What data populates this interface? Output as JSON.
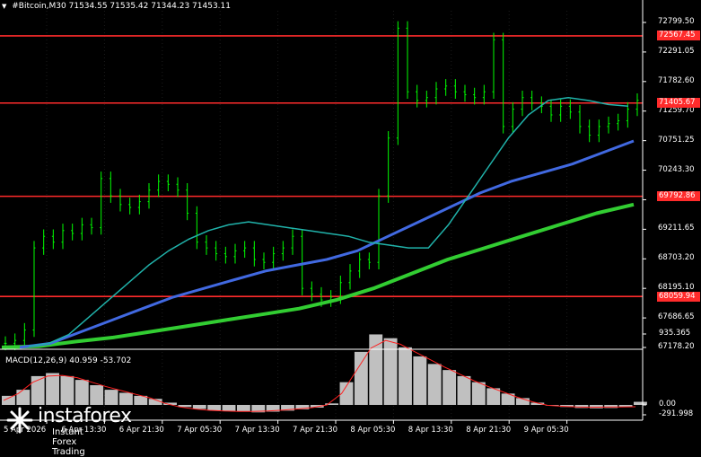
{
  "header": {
    "symbol": "#Bitcoin,M30",
    "ohlc": "71534.55 71535.42 71344.23 71453.11"
  },
  "indicator_label": "MACD(12,26,9) 40.959 -53.702",
  "watermark": {
    "name": "instaforex",
    "tagline": "Instant Forex Trading"
  },
  "price_axis": {
    "ticks": [
      "72799.50",
      "72291.05",
      "71782.60",
      "71259.70",
      "70751.25",
      "70243.30",
      "69735.35",
      "69211.65",
      "68703.20",
      "68195.10",
      "67686.65",
      "67178.20"
    ]
  },
  "horizontal_levels": [
    {
      "label": "72567.45",
      "color": "#ff2b2b"
    },
    {
      "label": "71405.67",
      "color": "#ff2b2b"
    },
    {
      "label": "69792.86",
      "color": "#ff2b2b"
    },
    {
      "label": "68059.94",
      "color": "#ff2b2b"
    }
  ],
  "macd_axis": {
    "ticks": [
      "935.365",
      "0.00",
      "-291.998"
    ]
  },
  "time_axis": {
    "labels": [
      "5 Apr 2026",
      "6 Apr 13:30",
      "6 Apr 21:30",
      "7 Apr 05:30",
      "7 Apr 13:30",
      "7 Apr 21:30",
      "8 Apr 05:30",
      "8 Apr 13:30",
      "8 Apr 21:30",
      "9 Apr 05:30"
    ]
  },
  "colors": {
    "background": "#000000",
    "candles": "#00ff00",
    "ma_fast": "#20b2aa",
    "ma_mid": "#4169e1",
    "ma_slow": "#32cd32",
    "macd_hist": "#c0c0c0",
    "macd_signal": "#ff2020",
    "level": "#ff2b2b"
  },
  "chart_data": {
    "type": "line",
    "title": "#Bitcoin,M30",
    "close_series": [
      67250,
      67300,
      67480,
      68900,
      69100,
      69000,
      69200,
      69150,
      69300,
      69250,
      70100,
      69800,
      69650,
      69600,
      69700,
      69900,
      70050,
      70000,
      69900,
      69500,
      69000,
      68900,
      68800,
      68750,
      68850,
      68900,
      68700,
      68650,
      68800,
      68900,
      69100,
      68200,
      68100,
      68000,
      68050,
      68300,
      68500,
      68700,
      68650,
      69800,
      70800,
      72700,
      71600,
      71450,
      71500,
      71650,
      71700,
      71600,
      71550,
      71500,
      71600,
      72500,
      71000,
      71300,
      71500,
      71400,
      71350,
      71200,
      71350,
      71250,
      71000,
      70850,
      71000,
      71050,
      71100,
      71300,
      71453
    ],
    "ma_fast": [
      67200,
      67250,
      67400,
      67700,
      68000,
      68300,
      68600,
      68850,
      69050,
      69200,
      69300,
      69350,
      69300,
      69250,
      69200,
      69150,
      69100,
      69000,
      68950,
      68900,
      68900,
      69300,
      69800,
      70300,
      70800,
      71200,
      71450,
      71500,
      71450,
      71380,
      71350
    ],
    "ma_mid": [
      67180,
      67250,
      67450,
      67650,
      67850,
      68050,
      68200,
      68350,
      68500,
      68600,
      68700,
      68850,
      69100,
      69350,
      69600,
      69850,
      70050,
      70200,
      70350,
      70550,
      70750
    ],
    "ma_slow": [
      67180,
      67200,
      67280,
      67350,
      67450,
      67550,
      67650,
      67750,
      67850,
      68000,
      68200,
      68450,
      68700,
      68900,
      69100,
      69300,
      69500,
      69650
    ],
    "macd_hist": [
      120,
      200,
      380,
      420,
      380,
      330,
      260,
      200,
      160,
      120,
      80,
      30,
      -60,
      -120,
      -160,
      -180,
      -200,
      -220,
      -200,
      -170,
      -130,
      -80,
      20,
      300,
      700,
      930,
      880,
      760,
      640,
      540,
      460,
      380,
      300,
      220,
      150,
      90,
      30,
      -20,
      -60,
      -90,
      -100,
      -90,
      -60,
      41
    ],
    "macd_signal": [
      60,
      150,
      300,
      380,
      390,
      360,
      300,
      240,
      190,
      140,
      90,
      20,
      -60,
      -120,
      -160,
      -180,
      -190,
      -190,
      -180,
      -150,
      -120,
      -80,
      0,
      150,
      450,
      750,
      850,
      800,
      700,
      600,
      500,
      410,
      320,
      240,
      170,
      100,
      40,
      -10,
      -40,
      -60,
      -70,
      -65,
      -58,
      -54
    ],
    "ylim": [
      67178.2,
      72799.5
    ]
  }
}
